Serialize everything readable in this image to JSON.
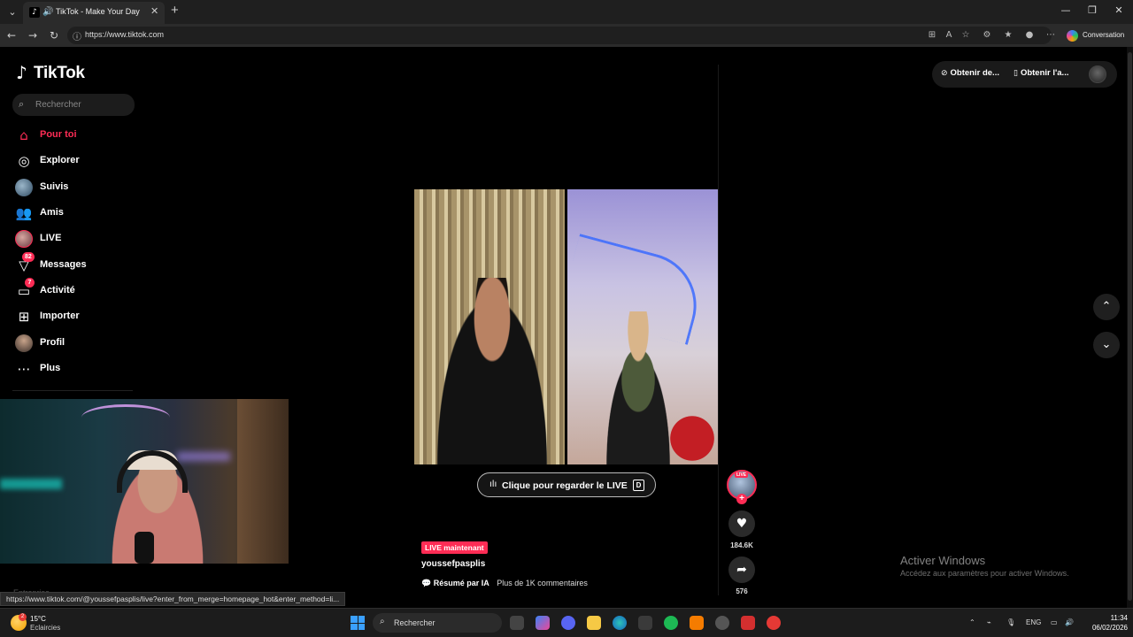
{
  "browser": {
    "tab_title": "TikTok - Make Your Day",
    "url": "https://www.tiktok.com",
    "copilot_label": "Conversation"
  },
  "tiktok": {
    "logo": "TikTok",
    "search_placeholder": "Rechercher",
    "nav": [
      {
        "label": "Pour toi",
        "icon": "home-icon",
        "active": true
      },
      {
        "label": "Explorer",
        "icon": "compass-icon"
      },
      {
        "label": "Suivis",
        "icon": "following-avatar"
      },
      {
        "label": "Amis",
        "icon": "friends-icon"
      },
      {
        "label": "LIVE",
        "icon": "live-avatar"
      },
      {
        "label": "Messages",
        "icon": "messages-icon",
        "badge": "82"
      },
      {
        "label": "Activité",
        "icon": "activity-icon",
        "badge": "7"
      },
      {
        "label": "Importer",
        "icon": "upload-icon"
      },
      {
        "label": "Profil",
        "icon": "profile-avatar"
      },
      {
        "label": "Plus",
        "icon": "more-icon"
      }
    ],
    "footer_cut": "Entreprise",
    "top_right": {
      "coins_label": "Obtenir de...",
      "app_label": "Obtenir l'a..."
    },
    "live": {
      "cta_label": "Clique pour regarder le LIVE",
      "cta_key": "D",
      "tag": "LIVE maintenant",
      "username": "youssefpasplis",
      "summary_label": "Résumé par IA",
      "comments_label": "Plus de 1K commentaires",
      "avatar_live_label": "LIVE",
      "likes": "184.6K",
      "shares": "576"
    },
    "status_url": "https://www.tiktok.com/@youssefpasplis/live?enter_from_merge=homepage_hot&enter_method=li..."
  },
  "windows": {
    "activate_title": "Activer Windows",
    "activate_sub": "Accédez aux paramètres pour activer Windows.",
    "temperature": "15°C",
    "condition": "Eclaircies",
    "weather_badge": "2",
    "taskbar_search": "Rechercher",
    "language": "ENG",
    "time": "11:34",
    "date": "06/02/2026"
  }
}
